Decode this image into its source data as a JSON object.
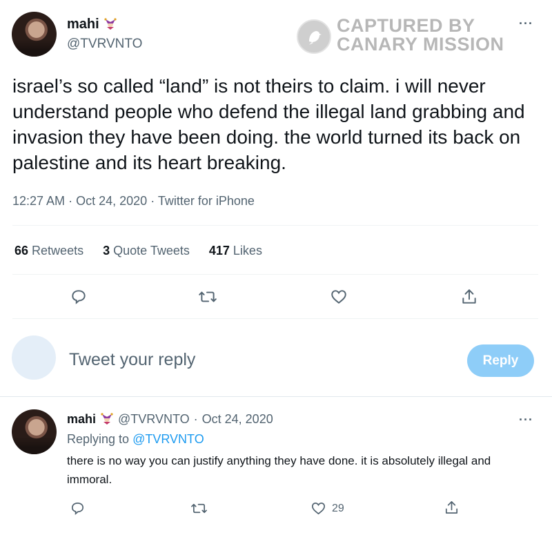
{
  "watermark": {
    "line1": "CAPTURED BY",
    "line2": "CANARY MISSION"
  },
  "tweet": {
    "author_name": "mahi",
    "author_handle": "@TVRVNTO",
    "more": "···",
    "text": "israel’s so called “land” is not theirs to claim. i will never understand people who defend the illegal land grabbing and invasion they have been doing. the world turned its back on palestine and its heart breaking.",
    "time": "12:27 AM",
    "date": "Oct 24, 2020",
    "source": "Twitter for iPhone",
    "sep": "·",
    "stats": {
      "retweets_count": "66",
      "retweets_label": "Retweets",
      "quotes_count": "3",
      "quotes_label": "Quote Tweets",
      "likes_count": "417",
      "likes_label": "Likes"
    }
  },
  "composer": {
    "placeholder": "Tweet your reply",
    "button": "Reply"
  },
  "reply": {
    "author_name": "mahi",
    "author_handle": "@TVRVNTO",
    "sep": "·",
    "date": "Oct 24, 2020",
    "replying_prefix": "Replying to",
    "replying_to": "@TVRVNTO",
    "text": "there is no way you can justify anything they have done. it is absolutely illegal and immoral.",
    "likes": "29",
    "more": "···"
  },
  "icons": {
    "reply": "speech-bubble",
    "retweet": "retweet-arrows",
    "like": "heart",
    "share": "upload-arrow",
    "emoji": "jester-emoji",
    "logo": "canary-bird"
  },
  "colors": {
    "accent": "#1d9bf0",
    "reply_button": "#8ecdf8",
    "secondary_text": "#536471",
    "divider": "#eff3f4"
  }
}
